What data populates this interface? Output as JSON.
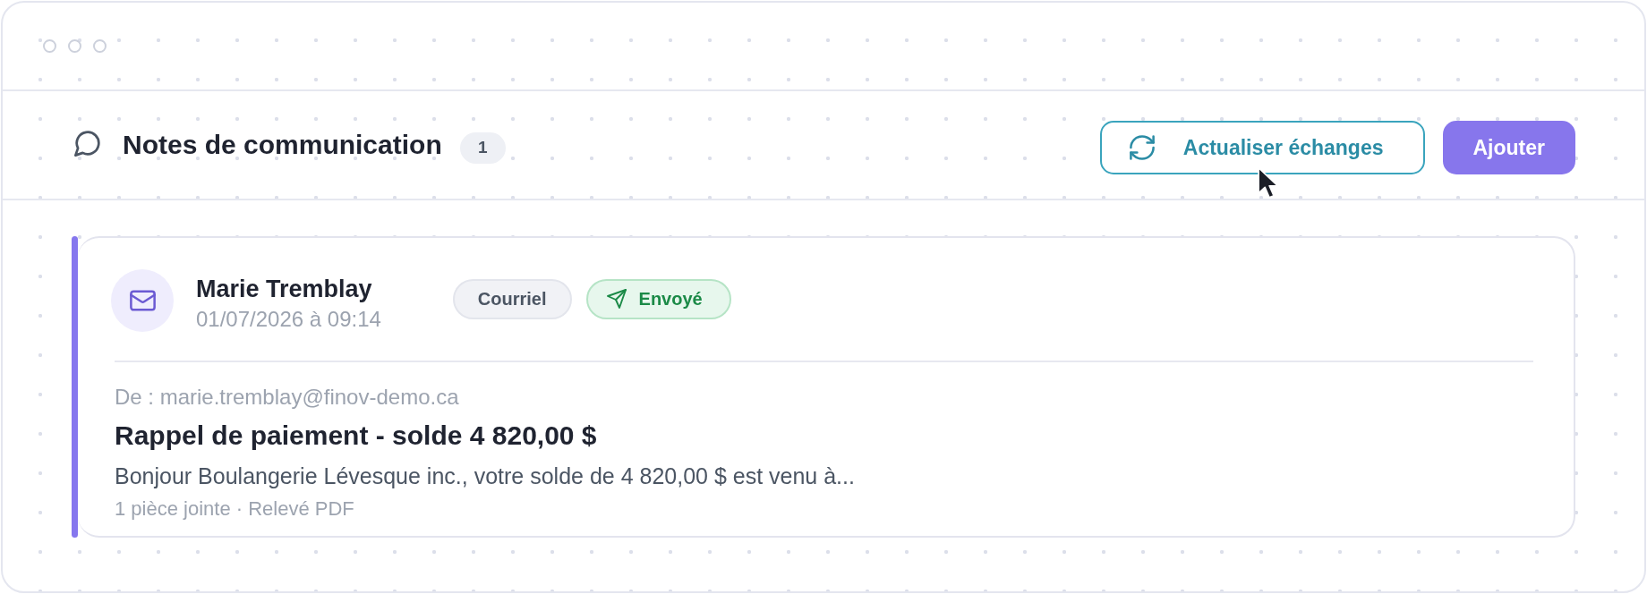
{
  "header": {
    "title": "Notes de communication",
    "count": "1",
    "actions": [
      {
        "label": "Actualiser échanges",
        "kind": "secondary"
      },
      {
        "label": "Ajouter",
        "kind": "primary"
      }
    ]
  },
  "notes": [
    {
      "author": "Marie Tremblay",
      "timestamp": "01/07/2026 à 09:14",
      "tags": [
        {
          "label": "Courriel",
          "kind": "channel"
        },
        {
          "label": "Envoyé",
          "kind": "status"
        }
      ],
      "from": "De : marie.tremblay@finov-demo.ca",
      "subject": "Rappel de paiement - solde 4 820,00 $",
      "preview": "Bonjour Boulangerie Lévesque inc., votre solde de 4 820,00 $ est venu à...",
      "attachments": "1 pièce jointe · Relevé PDF"
    }
  ]
}
